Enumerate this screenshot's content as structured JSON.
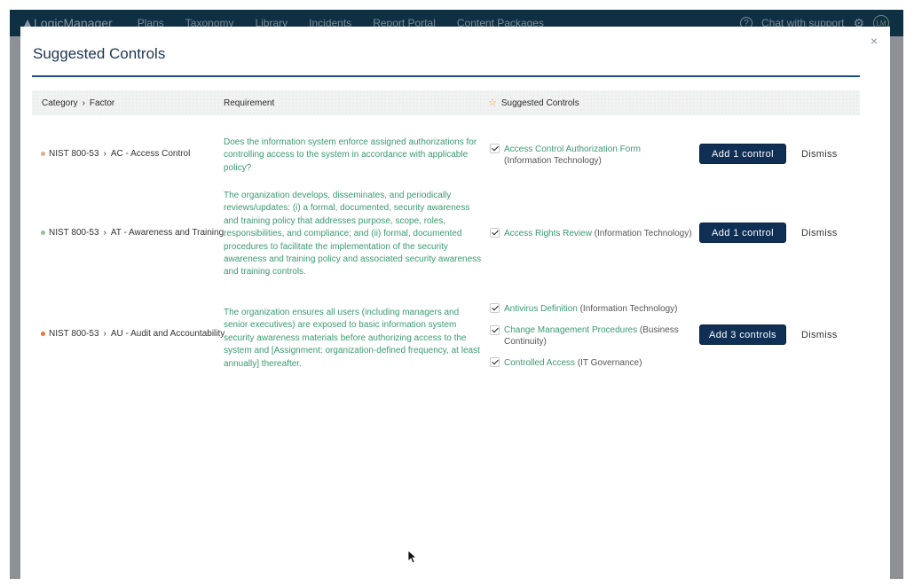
{
  "navbar": {
    "logo": "LogicManager",
    "items": [
      "Plans",
      "Taxonomy",
      "Library",
      "Incidents",
      "Report Portal",
      "Content Packages"
    ],
    "help": "?",
    "chat": "Chat with support",
    "avatar": "LM"
  },
  "modal": {
    "title": "Suggested Controls",
    "close": "×",
    "headers": {
      "category": "Category",
      "factor": "Factor",
      "requirement": "Requirement",
      "controls": "Suggested Controls"
    },
    "rows": [
      {
        "category": "NIST 800-53",
        "factor": "AC - Access Control",
        "requirement": "Does the information system enforce assigned authorizations for controlling access to the system in accordance with applicable policy?",
        "controls": [
          {
            "name": "Access Control Authorization Form",
            "group": "(Information Technology)"
          }
        ],
        "button": "Add 1 control",
        "dismiss": "Dismiss"
      },
      {
        "category": "NIST 800-53",
        "factor": "AT - Awareness and Training",
        "requirement": "The organization develops, disseminates, and periodically reviews/updates: (i) a formal, documented, security awareness and training policy that addresses purpose, scope, roles, responsibilities, and compliance; and (ii) formal, documented procedures to facilitate the implementation of the security awareness and training policy and associated security awareness and training controls.",
        "controls": [
          {
            "name": "Access Rights Review",
            "group": "(Information Technology)"
          }
        ],
        "button": "Add 1 control",
        "dismiss": "Dismiss"
      },
      {
        "category": "NIST 800-53",
        "factor": "AU - Audit and Accountability",
        "requirement": "The organization ensures all users (including managers and senior executives) are exposed to basic information system security awareness materials before authorizing access to the system and [Assignment: organization-defined frequency, at least annually] thereafter.",
        "controls": [
          {
            "name": "Antivirus Definition",
            "group": "(Information Technology)"
          },
          {
            "name": "Change Management Procedures",
            "group": "(Business Continuity)"
          },
          {
            "name": "Controlled Access",
            "group": "(IT Governance)"
          }
        ],
        "button": "Add 3 controls",
        "dismiss": "Dismiss"
      }
    ]
  },
  "colors": {
    "navbar": "#0f2f42",
    "accent": "#1d4f86",
    "link": "#3a9a72",
    "button": "#0f2f55",
    "dot_ac": "#e8a98a",
    "dot_at": "#8fc39b",
    "dot_au": "#e8743b"
  }
}
